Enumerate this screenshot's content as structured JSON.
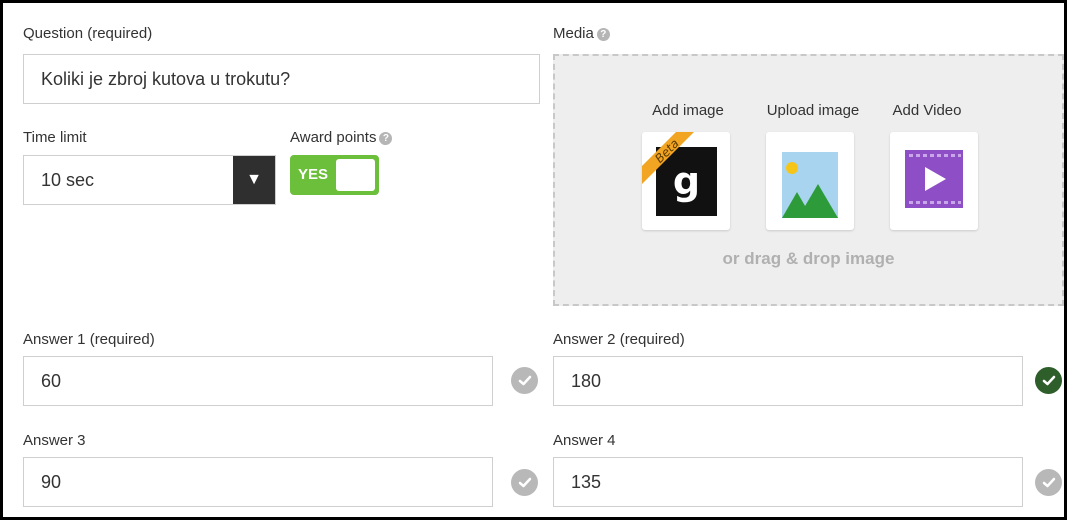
{
  "question": {
    "label": "Question (required)",
    "value": "Koliki je zbroj kutova u trokutu?"
  },
  "time_limit": {
    "label": "Time limit",
    "value": "10 sec",
    "arrow_icon": "▼"
  },
  "award_points": {
    "label": "Award points",
    "toggle_text": "YES",
    "help_icon": "?"
  },
  "media": {
    "label": "Media",
    "help_icon": "?",
    "options": [
      {
        "label": "Add image",
        "badge": "Beta",
        "logo_letter": "g",
        "icon": "getty-image-icon"
      },
      {
        "label": "Upload image",
        "icon": "image-upload-icon"
      },
      {
        "label": "Add Video",
        "icon": "video-icon"
      }
    ],
    "drop_text": "or drag & drop image"
  },
  "answers": [
    {
      "label": "Answer 1 (required)",
      "value": "60",
      "correct": false
    },
    {
      "label": "Answer 2 (required)",
      "value": "180",
      "correct": true
    },
    {
      "label": "Answer 3",
      "value": "90",
      "correct": false
    },
    {
      "label": "Answer 4",
      "value": "135",
      "correct": false
    }
  ],
  "colors": {
    "toggle_on": "#6cbf3a",
    "check_correct": "#2e5e2a",
    "check_inactive": "#b8b8b8",
    "select_arrow_bg": "#2f2f2f"
  }
}
